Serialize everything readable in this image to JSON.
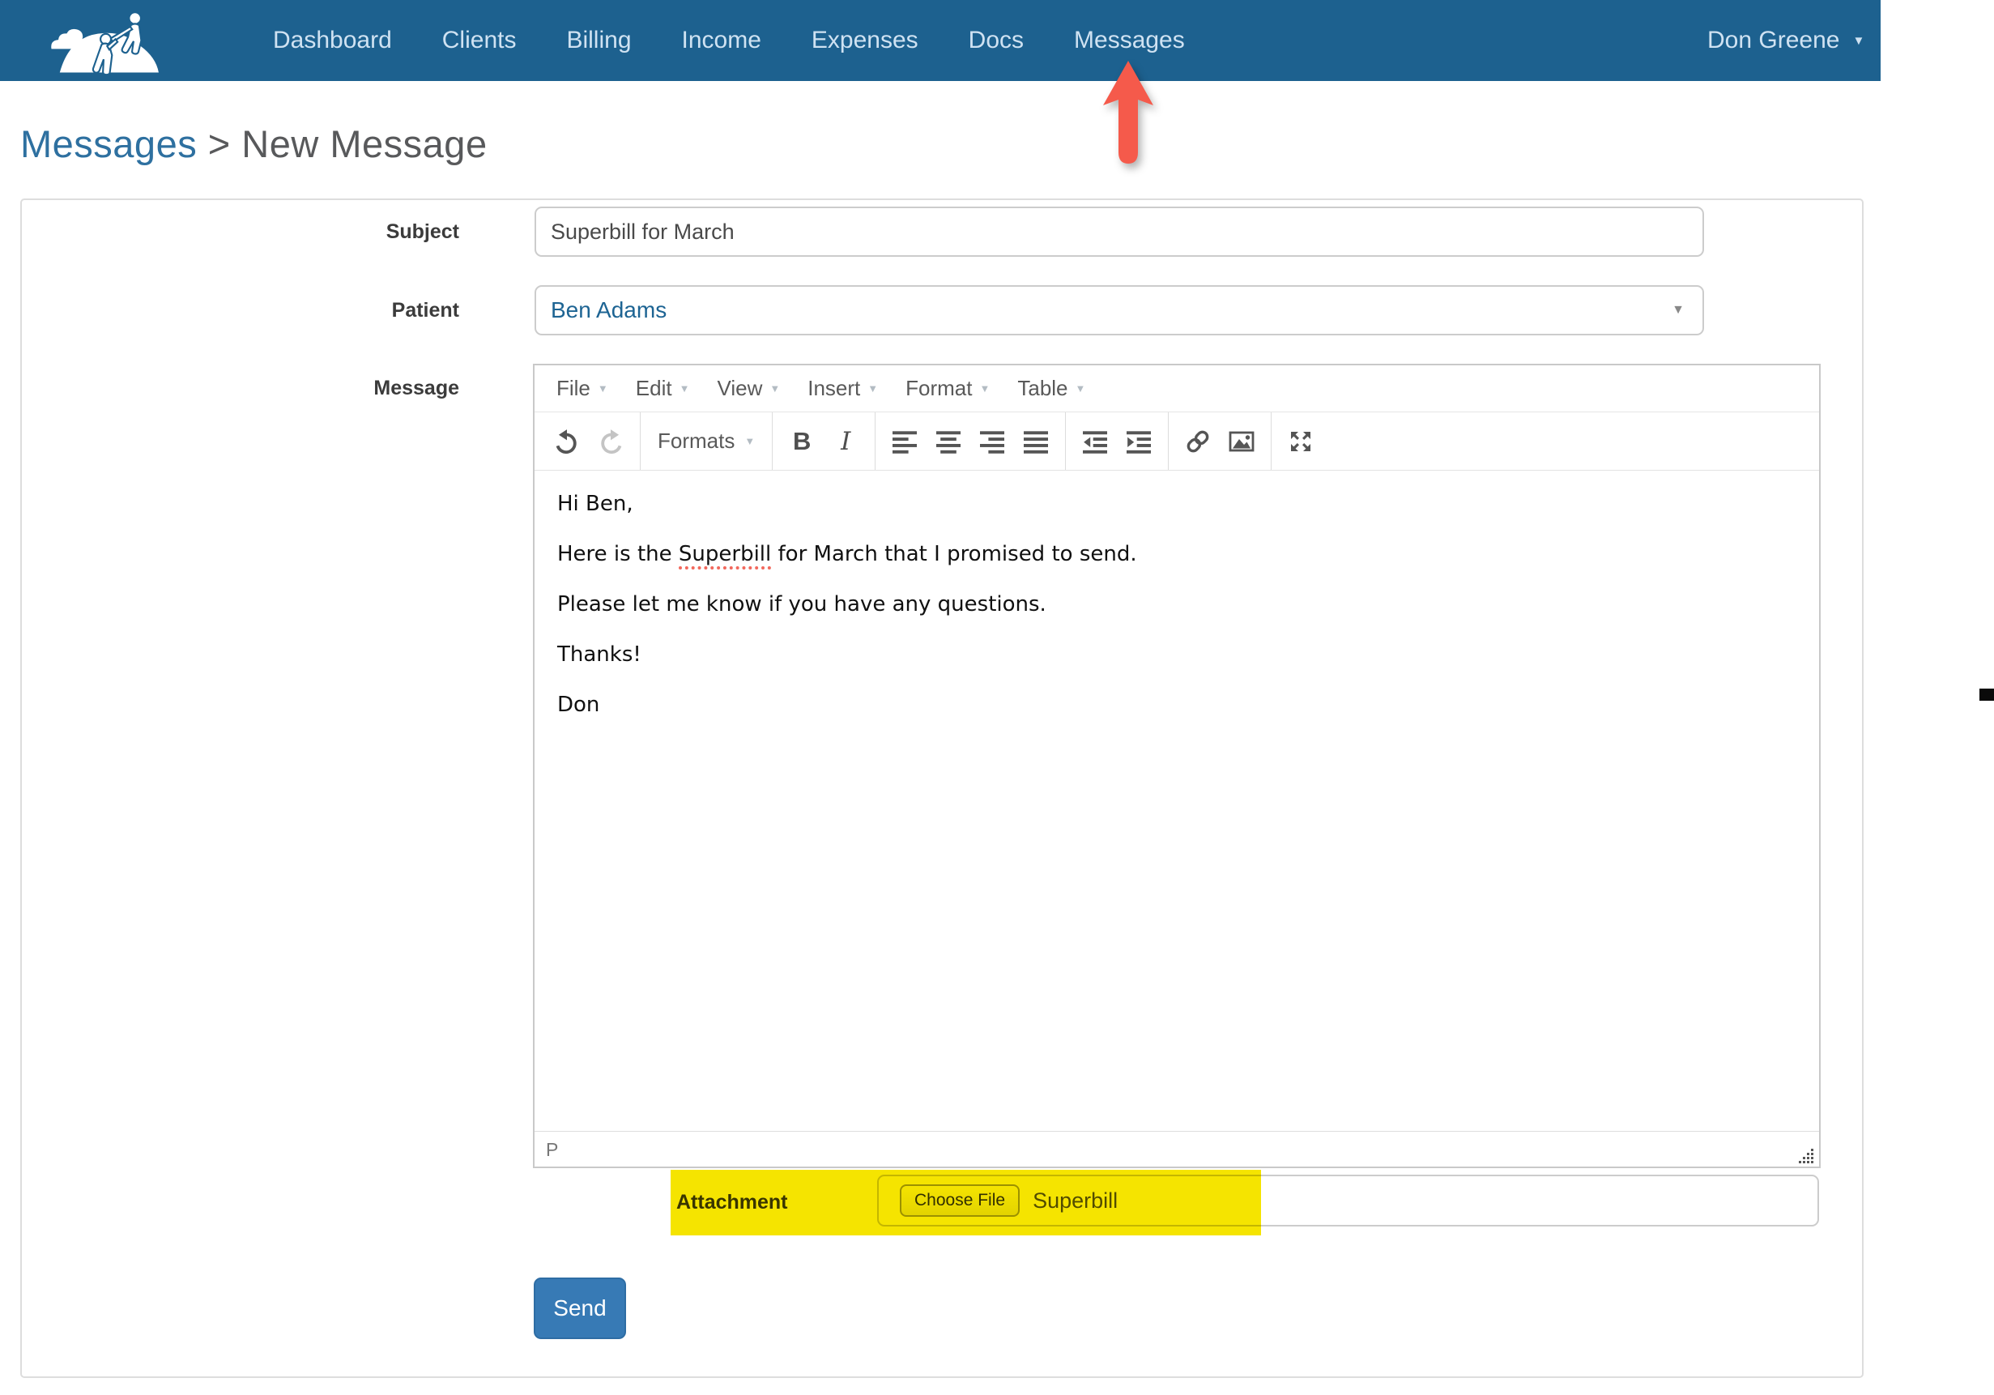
{
  "nav": {
    "items": [
      "Dashboard",
      "Clients",
      "Billing",
      "Income",
      "Expenses",
      "Docs",
      "Messages"
    ],
    "user": "Don Greene"
  },
  "breadcrumb": {
    "link": "Messages",
    "separator": ">",
    "current": "New Message"
  },
  "form": {
    "subject": {
      "label": "Subject",
      "value": "Superbill for March"
    },
    "patient": {
      "label": "Patient",
      "value": "Ben Adams"
    },
    "message": {
      "label": "Message"
    },
    "attachment": {
      "label": "Attachment",
      "button": "Choose File",
      "filename": "Superbill"
    },
    "send_label": "Send"
  },
  "editor": {
    "menus": [
      "File",
      "Edit",
      "View",
      "Insert",
      "Format",
      "Table"
    ],
    "toolbar": {
      "formats": "Formats",
      "bold": "B",
      "italic": "I"
    },
    "paragraphs": [
      "Hi Ben,",
      "Here is the Superbill for March that I promised to send.",
      "Please let me know if you have any questions.",
      "Thanks!",
      "Don"
    ],
    "spellcheck_word": "Superbill",
    "status_path": "P"
  },
  "colors": {
    "navbar": "#1d618f",
    "nav_text": "#cfe2f2",
    "breadcrumb_link": "#2e70a0",
    "send_button": "#377ab5",
    "patient_text": "#1d6493",
    "highlight_yellow": "#f5e400",
    "annotation_arrow": "#f55a4b",
    "spellcheck_underline": "#f2685c"
  }
}
